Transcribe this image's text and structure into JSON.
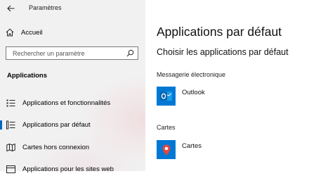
{
  "window": {
    "title": "Paramètres"
  },
  "sidebar": {
    "home_label": "Accueil",
    "search_placeholder": "Rechercher un paramètre",
    "section_heading": "Applications",
    "items": [
      {
        "label": "Applications et fonctionnalités",
        "icon": "apps-list-icon",
        "selected": false
      },
      {
        "label": "Applications par défaut",
        "icon": "default-apps-icon",
        "selected": true
      },
      {
        "label": "Cartes hors connexion",
        "icon": "offline-maps-icon",
        "selected": false
      },
      {
        "label": "Applications pour les sites web",
        "icon": "web-apps-icon",
        "selected": false
      }
    ]
  },
  "main": {
    "title": "Applications par défaut",
    "subtitle": "Choisir les applications par défaut",
    "categories": [
      {
        "label": "Messagerie électronique",
        "app": "Outlook",
        "icon": "outlook-icon",
        "color": "#0078d4"
      },
      {
        "label": "Cartes",
        "app": "Cartes",
        "icon": "maps-icon",
        "color": "#0078d4"
      }
    ]
  },
  "colors": {
    "accent": "#0067c0",
    "tile": "#0078d4",
    "sidebar_bg": "#f1f1f1"
  }
}
